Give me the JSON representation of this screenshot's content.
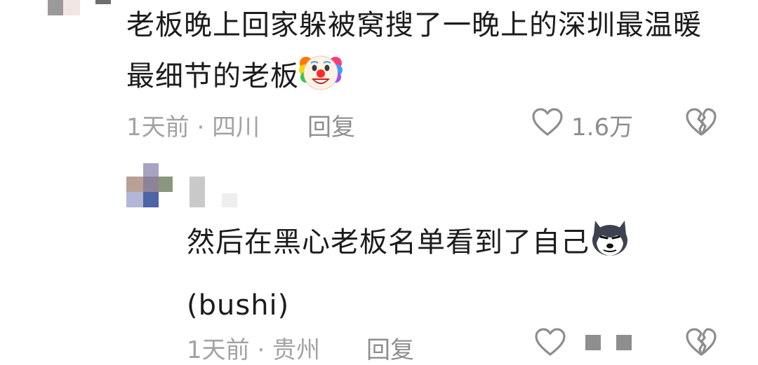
{
  "comments": [
    {
      "text": "老板晚上回家躲被窝搜了一晚上的深圳最温暖最细节的老板",
      "emoji": "clown-face",
      "time": "1天前",
      "location": "四川",
      "separator": "·",
      "reply_label": "回复",
      "like_count": "1.6万"
    },
    {
      "text": "然后在黑心老板名单看到了自己",
      "emoji": "husky-face",
      "suffix": "(bushi)",
      "time": "1天前",
      "location": "贵州",
      "separator": "·",
      "reply_label": "回复"
    }
  ],
  "colors": {
    "text": "#1c1c1c",
    "meta": "#a3a3a3",
    "icon": "#8e8e8e"
  }
}
